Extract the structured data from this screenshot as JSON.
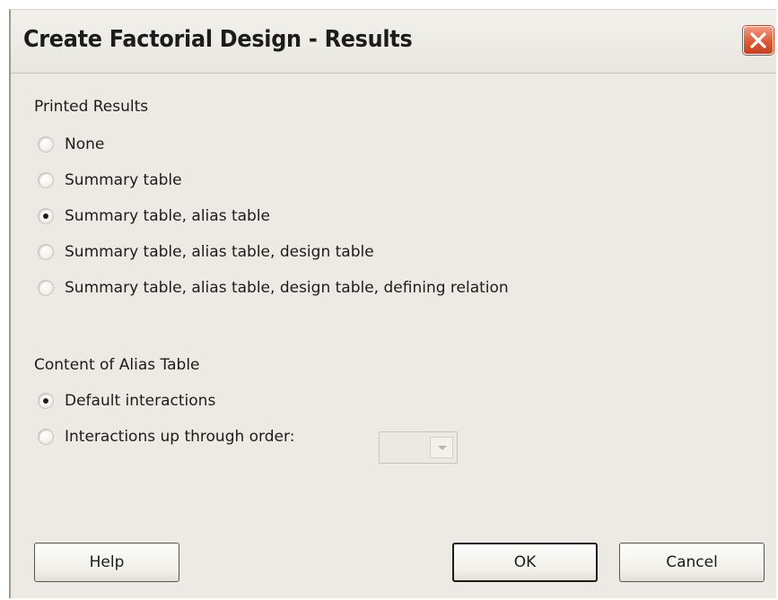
{
  "window": {
    "title": "Create Factorial Design - Results"
  },
  "printed_results": {
    "label": "Printed Results",
    "options": [
      {
        "label": "None",
        "selected": false
      },
      {
        "label": "Summary table",
        "selected": false
      },
      {
        "label": "Summary table, alias table",
        "selected": true
      },
      {
        "label": "Summary table, alias table, design table",
        "selected": false
      },
      {
        "label": "Summary table, alias table, design table, defining relation",
        "selected": false
      }
    ]
  },
  "alias_table": {
    "label": "Content of Alias Table",
    "options": [
      {
        "label": "Default interactions",
        "selected": true
      },
      {
        "label": "Interactions up through order:",
        "selected": false
      }
    ],
    "order_value": ""
  },
  "buttons": {
    "help": "Help",
    "ok": "OK",
    "cancel": "Cancel"
  },
  "icons": {
    "close": "close-icon",
    "dropdown": "chevron-down-icon"
  },
  "colors": {
    "dialog_bg": "#eceae2",
    "close_button": "#dc5b36"
  }
}
